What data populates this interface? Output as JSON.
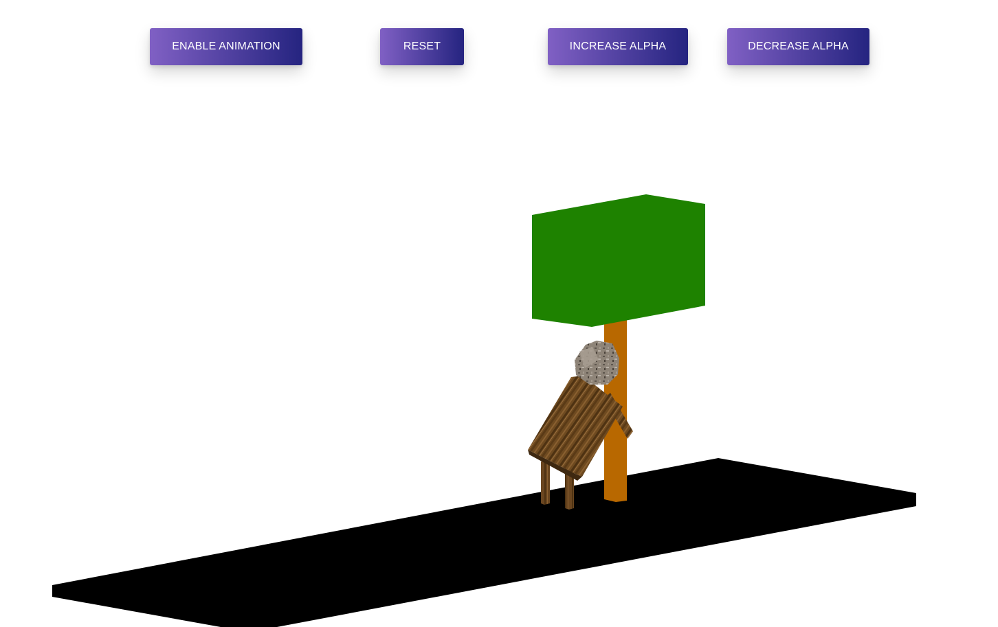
{
  "toolbar": {
    "enable_animation_label": "ENABLE ANIMATION",
    "reset_label": "RESET",
    "increase_alpha_label": "INCREASE ALPHA",
    "decrease_alpha_label": "DECREASE ALPHA"
  },
  "colors": {
    "button_gradient_start": "#8060c4",
    "button_gradient_end": "#252480",
    "tree_foliage": "#1e8200",
    "tree_trunk": "#b86800",
    "ground": "#000000",
    "wood_texture": "#6e4a20",
    "stone_texture": "#8e8478",
    "background": "#ffffff"
  },
  "scene": {
    "objects": [
      "ground-plane",
      "tree-foliage",
      "tree-trunk",
      "wooden-figure",
      "stone-head"
    ]
  }
}
